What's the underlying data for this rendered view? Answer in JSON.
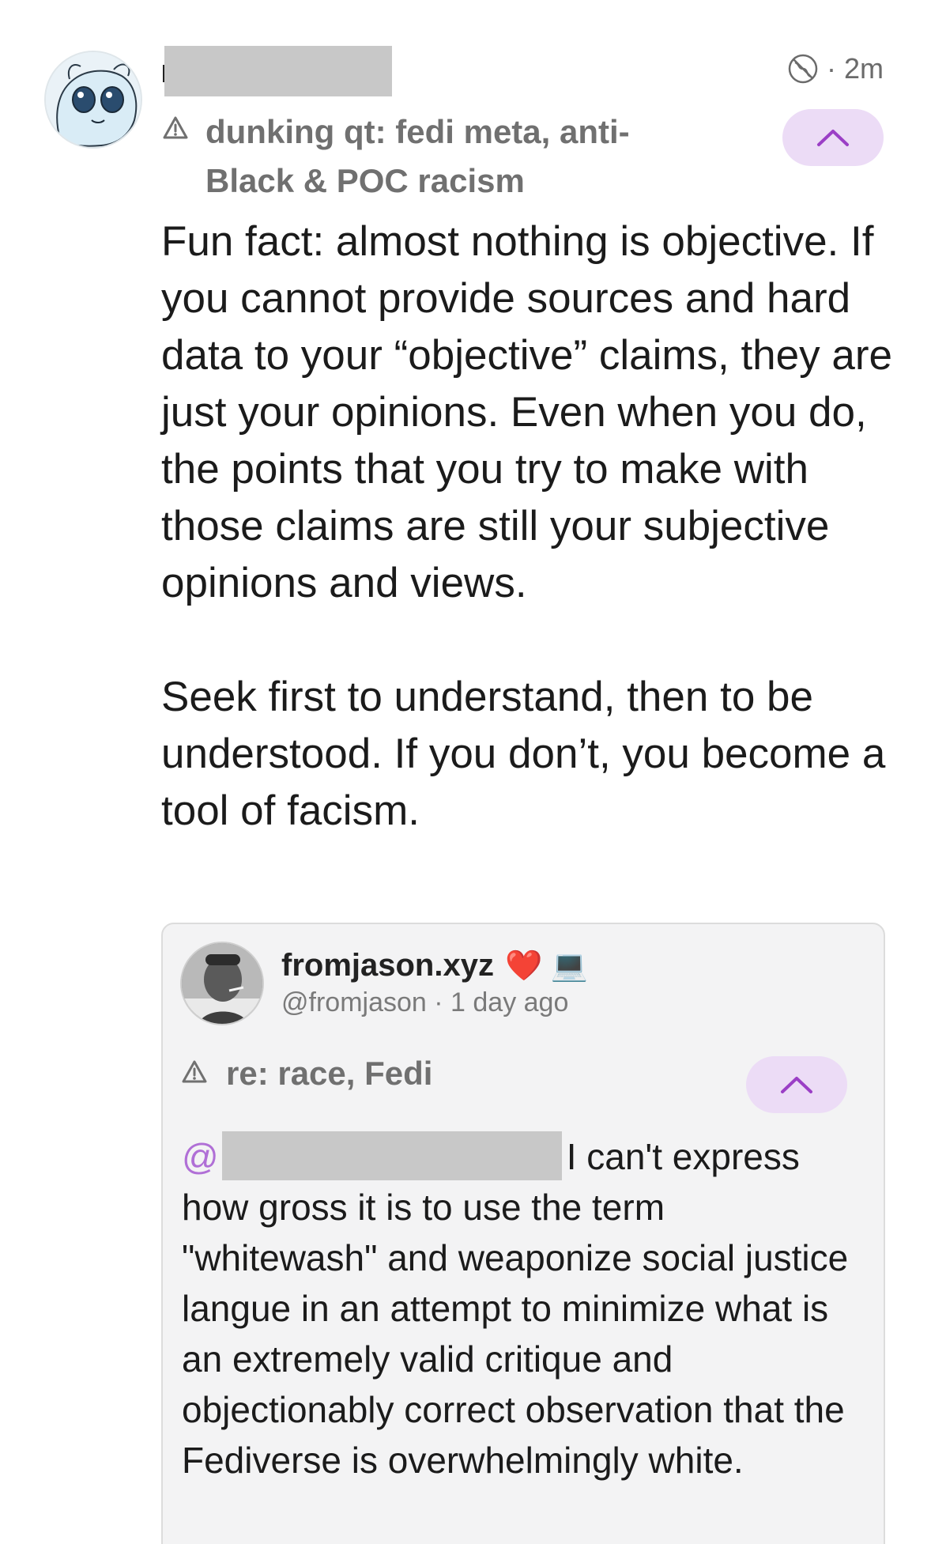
{
  "post": {
    "timestamp": "2m",
    "content_warning": "dunking qt: fedi meta, anti-Black & POC racism",
    "body": "Fun fact: almost nothing is objective. If you cannot provide sources and hard data to your “objective” claims, they are just your opinions. Even when you do, the points that you try to make with those claims are still your subjective opinions and views.\n\nSeek first to understand, then to be understood. If you don’t, you become a tool of facism."
  },
  "quote": {
    "display_name": "fromjason.xyz",
    "emoji": "❤️ 💻",
    "handle": "@fromjason",
    "time": "1 day ago",
    "content_warning": "re: race, Fedi",
    "mention_at": "@",
    "body": "I can't express how gross it is to use the term \"whitewash\" and weaponize social justice langue in an attempt to minimize what is an extremely valid critique and objectionably correct observation that the Fediverse is overwhelmingly white."
  },
  "colors": {
    "accent_button_bg": "#ecdcf6",
    "accent": "#b06fd6",
    "muted_text": "#707070"
  },
  "icons": {
    "visibility": "globe-off-icon",
    "content_warning": "warning-triangle-icon",
    "collapse": "chevron-up-icon"
  }
}
